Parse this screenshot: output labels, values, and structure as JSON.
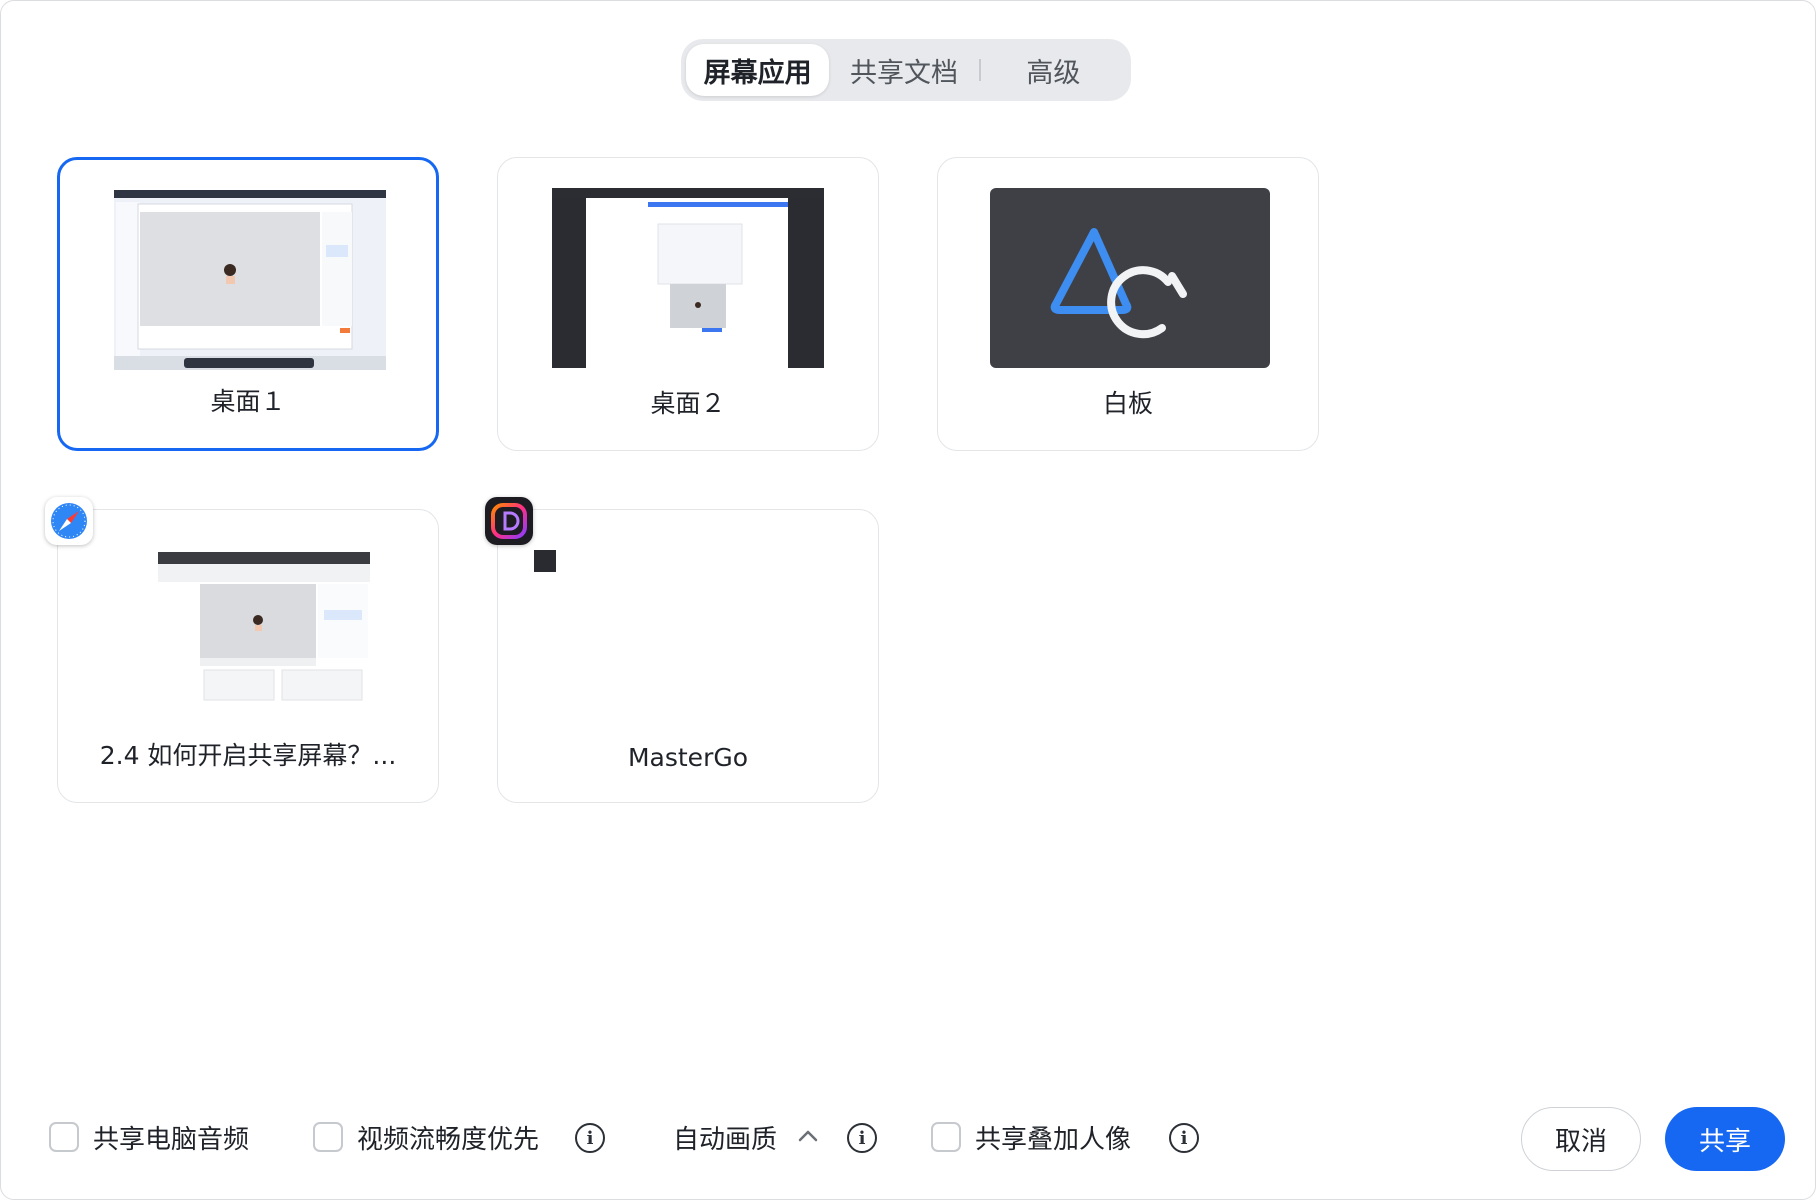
{
  "tabs": [
    {
      "label": "屏幕应用",
      "active": true
    },
    {
      "label": "共享文档",
      "active": false
    },
    {
      "label": "高级",
      "active": false
    }
  ],
  "sources": {
    "desktop1": {
      "label": "桌面１",
      "selected": true
    },
    "desktop2": {
      "label": "桌面２",
      "selected": false
    },
    "whiteboard": {
      "label": "白板",
      "selected": false
    },
    "safari_window": {
      "label": "2.4 如何开启共享屏幕？...",
      "app_icon": "safari-compass-icon"
    },
    "mastergo_window": {
      "label": "MasterGo",
      "app_icon": "mastergo-icon"
    }
  },
  "options": {
    "share_audio": {
      "label": "共享电脑音频",
      "checked": false
    },
    "video_fluency": {
      "label": "视频流畅度优先",
      "checked": false
    },
    "quality": {
      "label": "自动画质"
    },
    "share_portrait": {
      "label": "共享叠加人像",
      "checked": false
    }
  },
  "buttons": {
    "cancel": "取消",
    "share": "共享"
  },
  "colors": {
    "accent": "#1668f2",
    "whiteboard_bg": "#3f4045",
    "whiteboard_logo_blue": "#3d8ef0"
  }
}
